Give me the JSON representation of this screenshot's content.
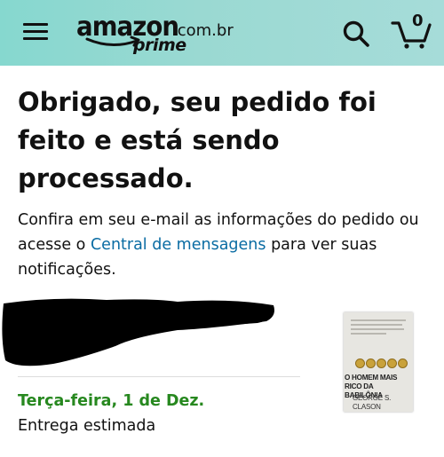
{
  "header": {
    "logo_word": "amazon",
    "logo_tld": ".com.br",
    "logo_prime": "prime",
    "cart_count": "0",
    "colors": {
      "bar": "#9ad9d2"
    },
    "icons": [
      "menu-icon",
      "search-icon",
      "cart-icon"
    ]
  },
  "confirmation": {
    "title": "Obrigado, seu pedido foi feito e está sendo processado.",
    "message_before": "Confira em seu e-mail as informações do pedido ou acesse o ",
    "message_link": "Central de mensagens",
    "message_after": " para ver suas notificações."
  },
  "order": {
    "delivery_date": "Terça-feira, 1 de Dez.",
    "delivery_label": "Entrega estimada",
    "product_cover": {
      "title": "O HOMEM MAIS RICO DA BABILÔNIA",
      "author": "GEORGE S. CLASON"
    },
    "colors": {
      "delivery_date": "#27881f",
      "link": "#0a6ca3"
    }
  }
}
